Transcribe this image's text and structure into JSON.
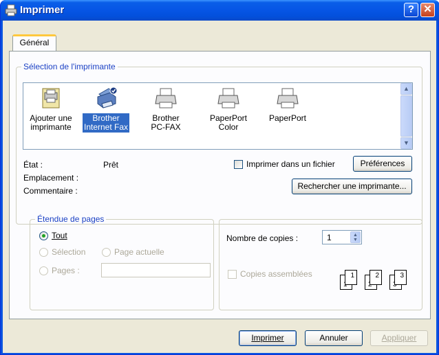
{
  "window": {
    "title": "Imprimer",
    "help_label": "?",
    "close_label": "✕"
  },
  "tabs": [
    {
      "label": "Général"
    }
  ],
  "printer_group": {
    "legend": "Sélection de l'imprimante",
    "printers": [
      {
        "line1": "Ajouter une",
        "line2": "imprimante",
        "icon": "add-printer-icon",
        "selected": false
      },
      {
        "line1": "Brother",
        "line2": "Internet Fax",
        "icon": "printer-icon",
        "selected": true
      },
      {
        "line1": "Brother",
        "line2": "PC-FAX",
        "icon": "printer-icon",
        "selected": false
      },
      {
        "line1": "PaperPort",
        "line2": "Color",
        "icon": "printer-icon",
        "selected": false
      },
      {
        "line1": "PaperPort",
        "line2": "",
        "icon": "printer-icon",
        "selected": false
      }
    ],
    "status_label": "État :",
    "status_value": "Prêt",
    "location_label": "Emplacement :",
    "comment_label": "Commentaire :",
    "print_to_file": {
      "label": "Imprimer dans un fichier",
      "checked": false
    },
    "preferences_button": "Préférences",
    "find_printer_button": "Rechercher une imprimante..."
  },
  "page_range": {
    "legend": "Étendue de pages",
    "all_label": "Tout",
    "selection_label": "Sélection",
    "current_page_label": "Page actuelle",
    "pages_label": "Pages :",
    "pages_value": "",
    "selected": "all"
  },
  "copies": {
    "count_label": "Nombre de copies :",
    "count_value": "1",
    "collate_label": "Copies assemblées",
    "collate_checked": false,
    "collate_pages": [
      "1",
      "1",
      "2",
      "2",
      "3",
      "3"
    ]
  },
  "footer": {
    "print_button": "Imprimer",
    "cancel_button": "Annuler",
    "apply_button": "Appliquer"
  },
  "colors": {
    "title_bar": "#0a53e0",
    "dialog_bg": "#ece9d8",
    "selection": "#316ac5",
    "legend_text": "#1b41c4"
  }
}
